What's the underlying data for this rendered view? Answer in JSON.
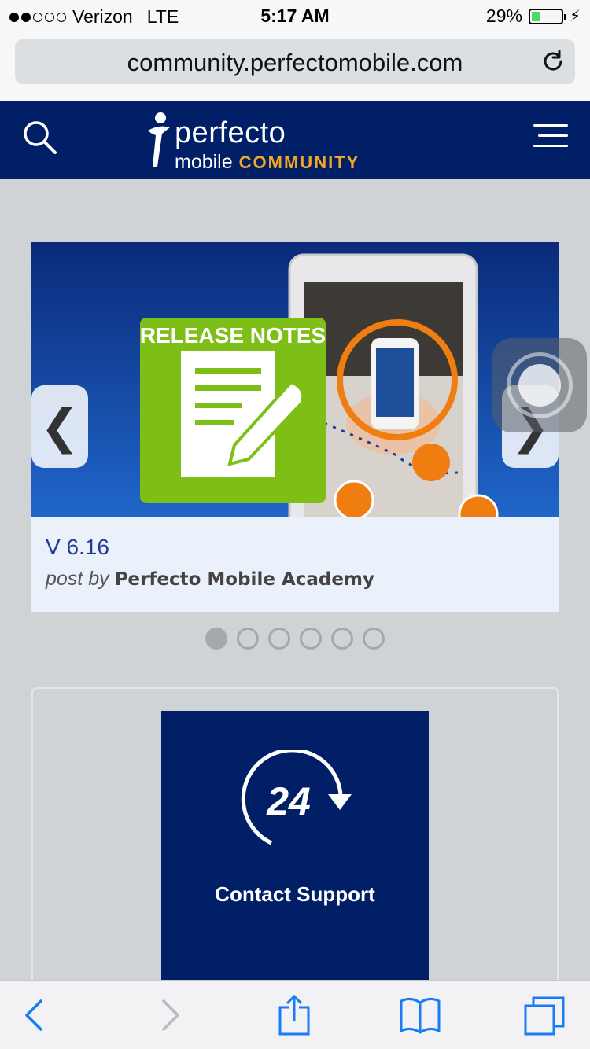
{
  "status_bar": {
    "carrier": "Verizon",
    "network": "LTE",
    "time": "5:17 AM",
    "battery_percent": "29%",
    "battery_level": 0.29,
    "signal_bars_on": 2,
    "signal_bars_total": 5
  },
  "browser": {
    "url": "community.perfectomobile.com"
  },
  "header": {
    "logo_word": "perfecto",
    "logo_sub": "mobile",
    "logo_community": "COMMUNITY",
    "colors": {
      "background": "#001f66",
      "accent": "#f5a623"
    }
  },
  "carousel": {
    "art_heading": "RELEASE NOTES",
    "slide_title": "V 6.16",
    "post_by_label": "post by",
    "author": "Perfecto Mobile Academy",
    "prev_glyph": "❮",
    "next_glyph": "❯",
    "active_index": 0,
    "total_slides": 6
  },
  "support": {
    "number": "24",
    "label": "Contact Support"
  },
  "toolbar": {
    "icons": [
      "back-icon",
      "forward-icon",
      "share-icon",
      "bookmarks-icon",
      "tabs-icon"
    ]
  }
}
